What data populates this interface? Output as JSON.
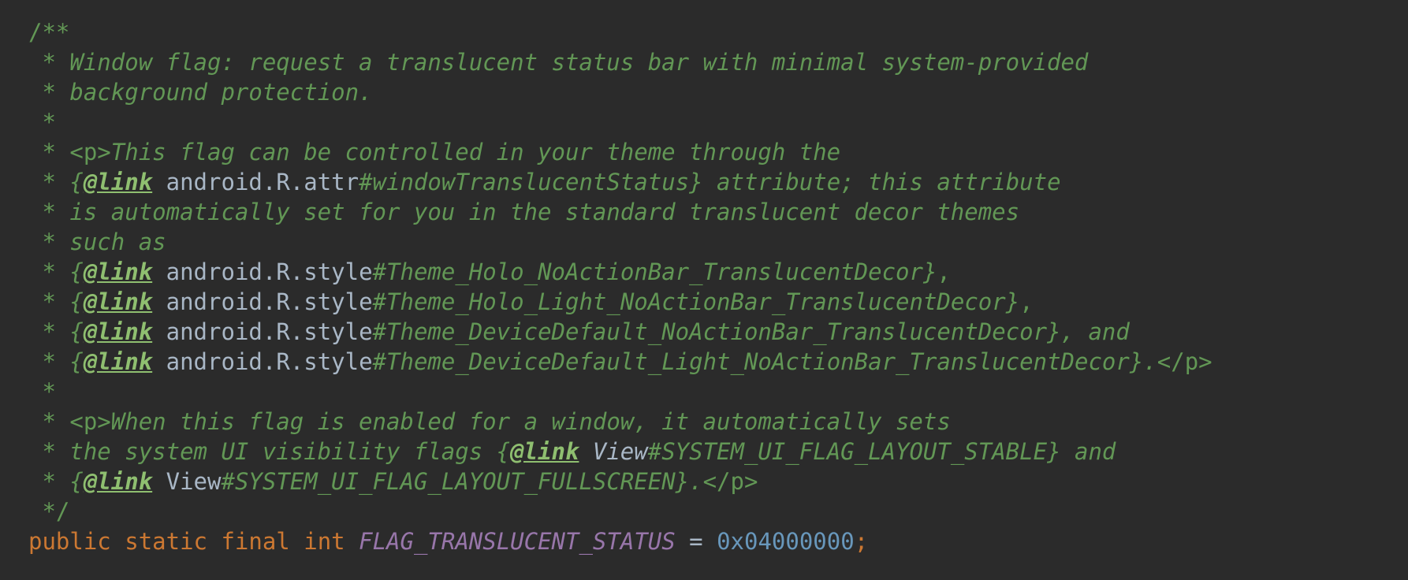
{
  "editor": {
    "comment": {
      "open": "/**",
      "star": " * ",
      "close": " */",
      "l1": "Window flag: request a translucent status bar with minimal system-provided",
      "l2": "background protection.",
      "p_open": "<p>",
      "p_close": "</p>",
      "l4_text": "This flag can be controlled in your theme through the",
      "brace_open": "{",
      "brace_close": "}",
      "link_tag": "@link",
      "l5_ref": "android.R",
      "l5_dot": ".",
      "l5_cls": "attr",
      "l5_member": "#windowTranslucentStatus",
      "l5_tail": " attribute; this attribute",
      "l6": "is automatically set for you in the standard translucent decor themes",
      "l7": "such as",
      "style_cls": "style",
      "l8_member": "#Theme_Holo_NoActionBar_TranslucentDecor",
      "l9_member": "#Theme_Holo_Light_NoActionBar_TranslucentDecor",
      "l10_member": "#Theme_DeviceDefault_NoActionBar_TranslucentDecor",
      "l11_member": "#Theme_DeviceDefault_Light_NoActionBar_TranslucentDecor",
      "comma": ",",
      "and_tail": ", and",
      "period": ".",
      "l13_text": "When this flag is enabled for a window, it automatically sets",
      "l14_text": "the system UI visibility flags ",
      "view_cls": "View",
      "l14_member": "#SYSTEM_UI_FLAG_LAYOUT_STABLE",
      "l14_tail": " and",
      "l15_member": "#SYSTEM_UI_FLAG_LAYOUT_FULLSCREEN"
    },
    "decl": {
      "kw_public": "public",
      "kw_static": "static",
      "kw_final": "final",
      "kw_int": "int",
      "name": "FLAG_TRANSLUCENT_STATUS",
      "eq": "=",
      "value": "0x04000000",
      "semi": ";"
    }
  }
}
